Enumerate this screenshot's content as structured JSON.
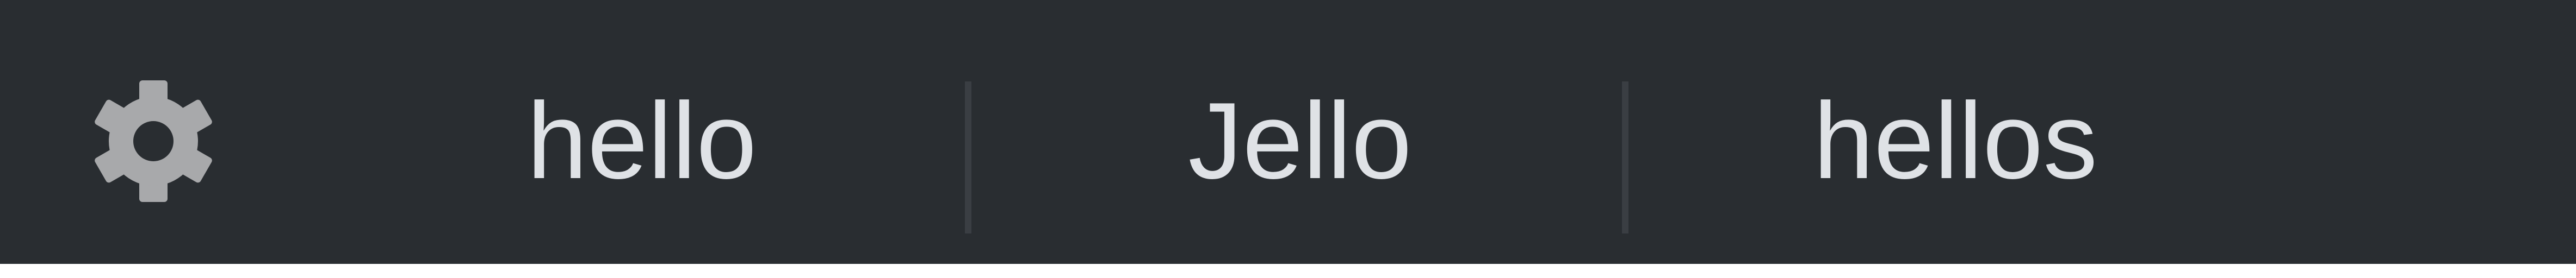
{
  "toolbar": {
    "settings_icon": "gear-icon",
    "items": [
      {
        "label": "hello"
      },
      {
        "label": "Jello"
      },
      {
        "label": "hellos"
      }
    ]
  },
  "colors": {
    "toolbar_background": "#292d31",
    "text": "#dfe2e6",
    "icon": "#a8a9ab",
    "divider": "#3a3e43"
  }
}
